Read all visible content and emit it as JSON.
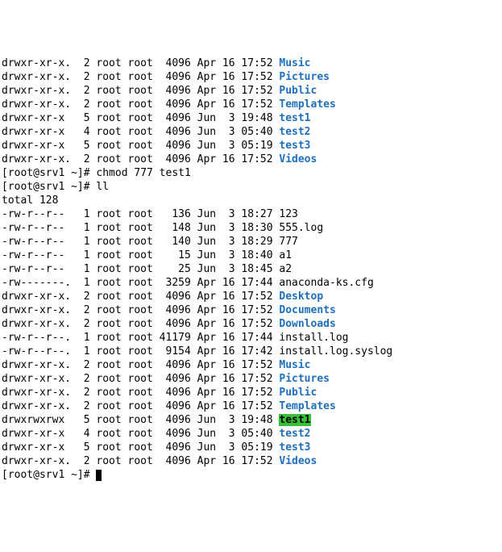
{
  "pre_ls": [
    {
      "perm": "drwxr-xr-x.",
      "links": "2",
      "owner": "root",
      "group": "root",
      "size": " 4096",
      "date": "Apr 16 17:52",
      "name": "Music",
      "type": "dir"
    },
    {
      "perm": "drwxr-xr-x.",
      "links": "2",
      "owner": "root",
      "group": "root",
      "size": " 4096",
      "date": "Apr 16 17:52",
      "name": "Pictures",
      "type": "dir"
    },
    {
      "perm": "drwxr-xr-x.",
      "links": "2",
      "owner": "root",
      "group": "root",
      "size": " 4096",
      "date": "Apr 16 17:52",
      "name": "Public",
      "type": "dir"
    },
    {
      "perm": "drwxr-xr-x.",
      "links": "2",
      "owner": "root",
      "group": "root",
      "size": " 4096",
      "date": "Apr 16 17:52",
      "name": "Templates",
      "type": "dir"
    },
    {
      "perm": "drwxr-xr-x ",
      "links": "5",
      "owner": "root",
      "group": "root",
      "size": " 4096",
      "date": "Jun  3 19:48",
      "name": "test1",
      "type": "dir"
    },
    {
      "perm": "drwxr-xr-x ",
      "links": "4",
      "owner": "root",
      "group": "root",
      "size": " 4096",
      "date": "Jun  3 05:40",
      "name": "test2",
      "type": "dir"
    },
    {
      "perm": "drwxr-xr-x ",
      "links": "5",
      "owner": "root",
      "group": "root",
      "size": " 4096",
      "date": "Jun  3 05:19",
      "name": "test3",
      "type": "dir"
    },
    {
      "perm": "drwxr-xr-x.",
      "links": "2",
      "owner": "root",
      "group": "root",
      "size": " 4096",
      "date": "Apr 16 17:52",
      "name": "Videos",
      "type": "dir"
    }
  ],
  "prompt1": "[root@srv1 ~]# ",
  "cmd1": "chmod 777 test1",
  "prompt2": "[root@srv1 ~]# ",
  "cmd2": "ll",
  "total_line": "total 128",
  "post_ls": [
    {
      "perm": "-rw-r--r-- ",
      "links": "1",
      "owner": "root",
      "group": "root",
      "size": "  136",
      "date": "Jun  3 18:27",
      "name": "123",
      "type": "file"
    },
    {
      "perm": "-rw-r--r-- ",
      "links": "1",
      "owner": "root",
      "group": "root",
      "size": "  148",
      "date": "Jun  3 18:30",
      "name": "555.log",
      "type": "file"
    },
    {
      "perm": "-rw-r--r-- ",
      "links": "1",
      "owner": "root",
      "group": "root",
      "size": "  140",
      "date": "Jun  3 18:29",
      "name": "777",
      "type": "file"
    },
    {
      "perm": "-rw-r--r-- ",
      "links": "1",
      "owner": "root",
      "group": "root",
      "size": "   15",
      "date": "Jun  3 18:40",
      "name": "a1",
      "type": "file"
    },
    {
      "perm": "-rw-r--r-- ",
      "links": "1",
      "owner": "root",
      "group": "root",
      "size": "   25",
      "date": "Jun  3 18:45",
      "name": "a2",
      "type": "file"
    },
    {
      "perm": "-rw-------.",
      "links": "1",
      "owner": "root",
      "group": "root",
      "size": " 3259",
      "date": "Apr 16 17:44",
      "name": "anaconda-ks.cfg",
      "type": "file"
    },
    {
      "perm": "drwxr-xr-x.",
      "links": "2",
      "owner": "root",
      "group": "root",
      "size": " 4096",
      "date": "Apr 16 17:52",
      "name": "Desktop",
      "type": "dir"
    },
    {
      "perm": "drwxr-xr-x.",
      "links": "2",
      "owner": "root",
      "group": "root",
      "size": " 4096",
      "date": "Apr 16 17:52",
      "name": "Documents",
      "type": "dir"
    },
    {
      "perm": "drwxr-xr-x.",
      "links": "2",
      "owner": "root",
      "group": "root",
      "size": " 4096",
      "date": "Apr 16 17:52",
      "name": "Downloads",
      "type": "dir"
    },
    {
      "perm": "-rw-r--r--.",
      "links": "1",
      "owner": "root",
      "group": "root",
      "size": "41179",
      "date": "Apr 16 17:44",
      "name": "install.log",
      "type": "file"
    },
    {
      "perm": "-rw-r--r--.",
      "links": "1",
      "owner": "root",
      "group": "root",
      "size": " 9154",
      "date": "Apr 16 17:42",
      "name": "install.log.syslog",
      "type": "file"
    },
    {
      "perm": "drwxr-xr-x.",
      "links": "2",
      "owner": "root",
      "group": "root",
      "size": " 4096",
      "date": "Apr 16 17:52",
      "name": "Music",
      "type": "dir"
    },
    {
      "perm": "drwxr-xr-x.",
      "links": "2",
      "owner": "root",
      "group": "root",
      "size": " 4096",
      "date": "Apr 16 17:52",
      "name": "Pictures",
      "type": "dir"
    },
    {
      "perm": "drwxr-xr-x.",
      "links": "2",
      "owner": "root",
      "group": "root",
      "size": " 4096",
      "date": "Apr 16 17:52",
      "name": "Public",
      "type": "dir"
    },
    {
      "perm": "drwxr-xr-x.",
      "links": "2",
      "owner": "root",
      "group": "root",
      "size": " 4096",
      "date": "Apr 16 17:52",
      "name": "Templates",
      "type": "dir"
    },
    {
      "perm": "drwxrwxrwx ",
      "links": "5",
      "owner": "root",
      "group": "root",
      "size": " 4096",
      "date": "Jun  3 19:48",
      "name": "test1",
      "type": "hi"
    },
    {
      "perm": "drwxr-xr-x ",
      "links": "4",
      "owner": "root",
      "group": "root",
      "size": " 4096",
      "date": "Jun  3 05:40",
      "name": "test2",
      "type": "dir"
    },
    {
      "perm": "drwxr-xr-x ",
      "links": "5",
      "owner": "root",
      "group": "root",
      "size": " 4096",
      "date": "Jun  3 05:19",
      "name": "test3",
      "type": "dir"
    },
    {
      "perm": "drwxr-xr-x.",
      "links": "2",
      "owner": "root",
      "group": "root",
      "size": " 4096",
      "date": "Apr 16 17:52",
      "name": "Videos",
      "type": "dir"
    }
  ],
  "prompt3": "[root@srv1 ~]# "
}
